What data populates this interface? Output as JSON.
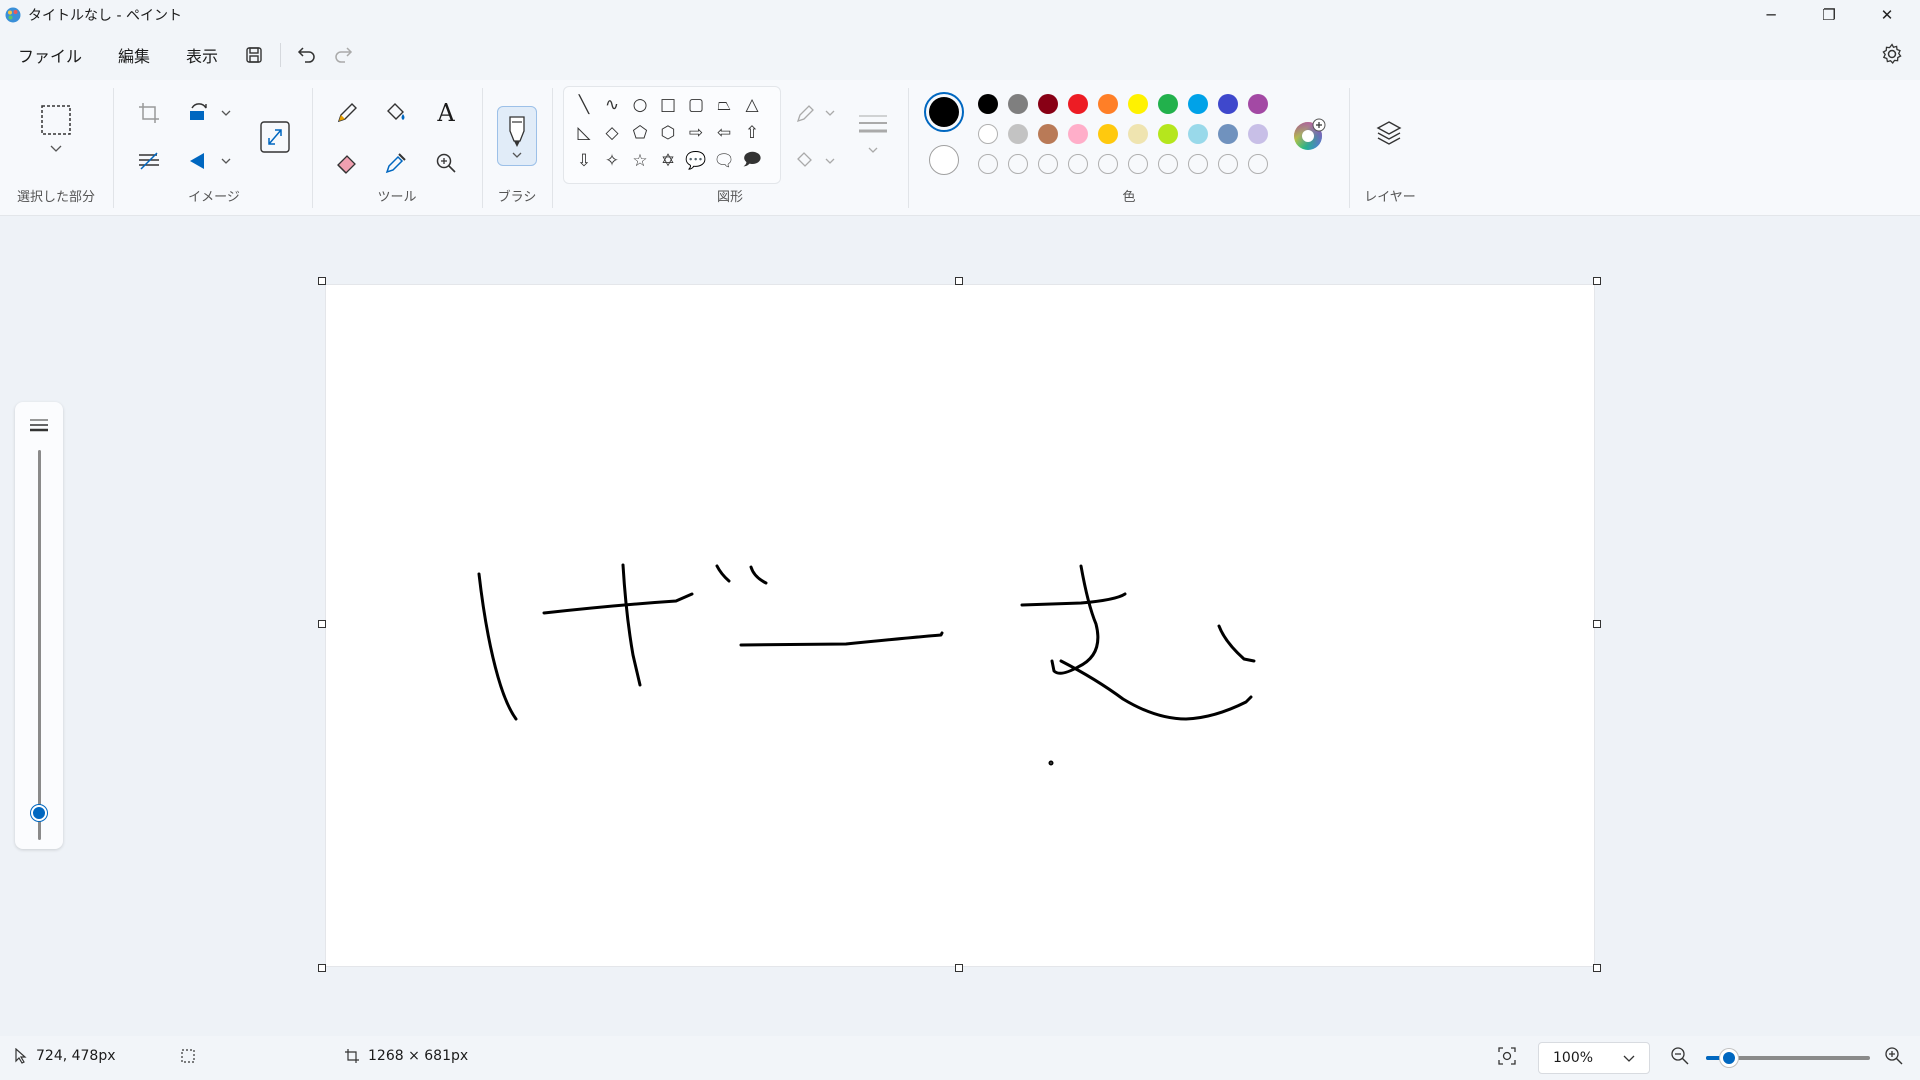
{
  "window": {
    "title": "タイトルなし - ペイント",
    "minimize_glyph": "─",
    "maximize_glyph": "❐",
    "close_glyph": "✕"
  },
  "menu": {
    "items": [
      "ファイル",
      "編集",
      "表示"
    ]
  },
  "ribbon": {
    "groups": {
      "selection": "選択した部分",
      "image": "イメージ",
      "tools": "ツール",
      "brush": "ブラシ",
      "shapes": "図形",
      "colors": "色",
      "layers": "レイヤー"
    },
    "text_tool_glyph": "A",
    "shape_glyphs": [
      "╲",
      "∿",
      "○",
      "□",
      "▢",
      "⏢",
      "△",
      "◺",
      "◇",
      "⬠",
      "⬡",
      "⇨",
      "⇦",
      "⇧",
      "⇩",
      "✧",
      "☆",
      "✡",
      "💬",
      "🗨",
      "🗩"
    ],
    "primary_color": "#000000",
    "secondary_color": "#ffffff",
    "palette_row1": [
      "#000000",
      "#7f7f7f",
      "#880015",
      "#ed1c24",
      "#ff7f27",
      "#fff200",
      "#22b14c",
      "#00a2e8",
      "#3f48cc",
      "#a349a4"
    ],
    "palette_row2": [
      "#ffffff",
      "#c3c3c3",
      "#b97a57",
      "#ffaec9",
      "#ffc90e",
      "#efe4b0",
      "#b5e61d",
      "#99d9ea",
      "#7092be",
      "#c8bfe7"
    ],
    "palette_row3_empty": 10
  },
  "status": {
    "cursor_position": "724, 478px",
    "canvas_size": "1268 × 681px",
    "zoom": "100%"
  },
  "brush_size_level": 0.04,
  "zoom_slider_level": 0.14
}
